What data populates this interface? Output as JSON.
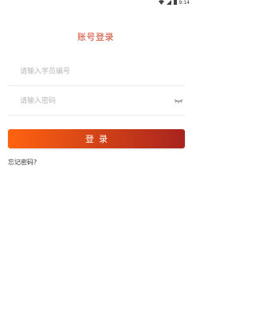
{
  "status_bar": {
    "time": "9:14",
    "icons": [
      "wifi-icon",
      "signal-icon",
      "battery-icon"
    ]
  },
  "login": {
    "title": "账号登录",
    "student_id": {
      "placeholder": "请输入学员编号",
      "value": ""
    },
    "password": {
      "placeholder": "请输入密码",
      "value": "",
      "toggle_icon": "eye-closed-icon"
    },
    "submit_label": "登录",
    "forgot_label": "忘记密码?"
  },
  "colors": {
    "title": "#d0442a",
    "button_gradient_start": "#ff6310",
    "button_gradient_end": "#a8231e",
    "placeholder": "#b8b8b8",
    "divider": "#ededed"
  }
}
